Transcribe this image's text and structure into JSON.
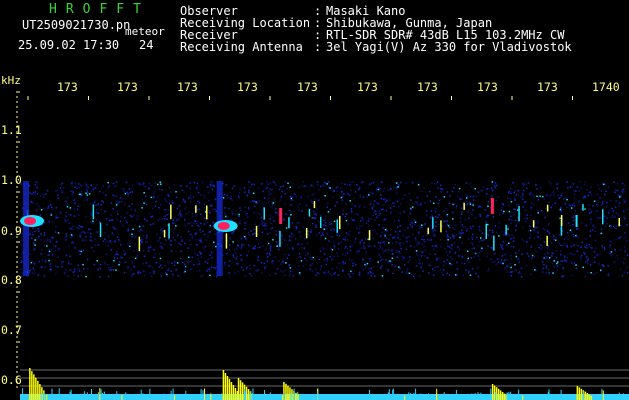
{
  "header": {
    "title": "HROFFT",
    "filename": "UT2509021730.pn",
    "tag": "meteor",
    "timestamp": "25.09.02 17:30",
    "count": "24"
  },
  "info": [
    {
      "label": "Observer",
      "value": "Masaki Kano"
    },
    {
      "label": "Receiving Location",
      "value": "Shibukawa, Gunma, Japan"
    },
    {
      "label": "Receiver",
      "value": "RTL-SDR SDR# 43dB L15 103.2MHz CW"
    },
    {
      "label": "Receiving Antenna",
      "value": "3el Yagi(V) Az 330 for Vladivostok"
    }
  ],
  "colon": ":",
  "axis": {
    "unit": "kHz",
    "x_ticks": [
      "173",
      "173",
      "173",
      "173",
      "173",
      "173",
      "173",
      "173",
      "173",
      "1740"
    ],
    "y_ticks": [
      "1.1",
      "1.0",
      "0.9",
      "0.8",
      "0.7",
      "0.6"
    ]
  },
  "colors": {
    "title": "#3cd23c",
    "background": "#000000",
    "noise": "#1428c8",
    "echo_hot": "#ff2060",
    "echo_warm": "#20e0ff",
    "meter": "#ffff00",
    "meter_base": "#30d0ff",
    "axis_text": "#ffff80"
  },
  "chart_data": {
    "type": "heatmap",
    "x_ticks": [
      "173",
      "173",
      "173",
      "173",
      "173",
      "173",
      "173",
      "173",
      "173",
      "1740"
    ],
    "y_ticks": [
      1.1,
      1.0,
      0.9,
      0.8,
      0.7,
      0.6
    ],
    "ylabel": "kHz",
    "freq_band": [
      0.81,
      1.0
    ],
    "ylim": [
      0.57,
      1.15
    ],
    "echoes": [
      {
        "minute": 0.1,
        "freq": 0.92,
        "strength": "strong"
      },
      {
        "minute": 3.3,
        "freq": 0.91,
        "strength": "strong"
      },
      {
        "minute": 4.3,
        "freq": 0.93,
        "strength": "medium"
      },
      {
        "minute": 7.8,
        "freq": 0.95,
        "strength": "medium"
      },
      {
        "minute": 9.2,
        "freq": 0.92,
        "strength": "weak"
      }
    ]
  }
}
